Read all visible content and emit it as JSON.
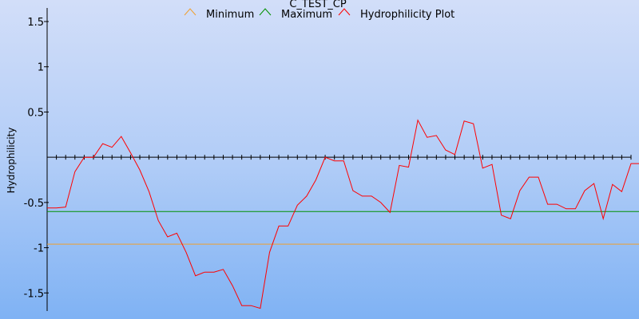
{
  "chart_data": {
    "type": "line",
    "title": "C_TEST_CP",
    "xlabel": "",
    "ylabel": "Hydrophilicity",
    "ylim": [
      -1.7,
      1.65
    ],
    "xlim": [
      0,
      63
    ],
    "yticks": [
      1.5,
      1,
      0.5,
      -0.5,
      -1,
      -1.5
    ],
    "ytick_labels": [
      "1.5",
      "1",
      "0.5",
      "-0.5",
      "-1",
      "-1.5"
    ],
    "xtick_count": 64,
    "grid": false,
    "legend": "top-center",
    "series": [
      {
        "name": "Minimum",
        "color": "#f0a030",
        "values": [
          -0.96,
          -0.96
        ]
      },
      {
        "name": "Maximum",
        "color": "#009000",
        "values": [
          -0.6,
          -0.6
        ]
      },
      {
        "name": "Hydrophilicity Plot",
        "color": "#ff0000",
        "values": [
          -0.56,
          -0.56,
          -0.55,
          -0.16,
          0.0,
          0.0,
          0.15,
          0.11,
          0.23,
          0.05,
          -0.14,
          -0.38,
          -0.7,
          -0.88,
          -0.84,
          -1.05,
          -1.31,
          -1.27,
          -1.27,
          -1.24,
          -1.42,
          -1.64,
          -1.64,
          -1.67,
          -1.05,
          -0.76,
          -0.76,
          -0.53,
          -0.43,
          -0.25,
          0.0,
          -0.04,
          -0.04,
          -0.37,
          -0.43,
          -0.43,
          -0.5,
          -0.61,
          -0.09,
          -0.11,
          0.41,
          0.22,
          0.24,
          0.08,
          0.03,
          0.4,
          0.37,
          -0.12,
          -0.08,
          -0.64,
          -0.68,
          -0.37,
          -0.22,
          -0.22,
          -0.52,
          -0.52,
          -0.57,
          -0.57,
          -0.37,
          -0.29,
          -0.68,
          -0.3,
          -0.38,
          -0.07,
          -0.07
        ]
      }
    ]
  }
}
